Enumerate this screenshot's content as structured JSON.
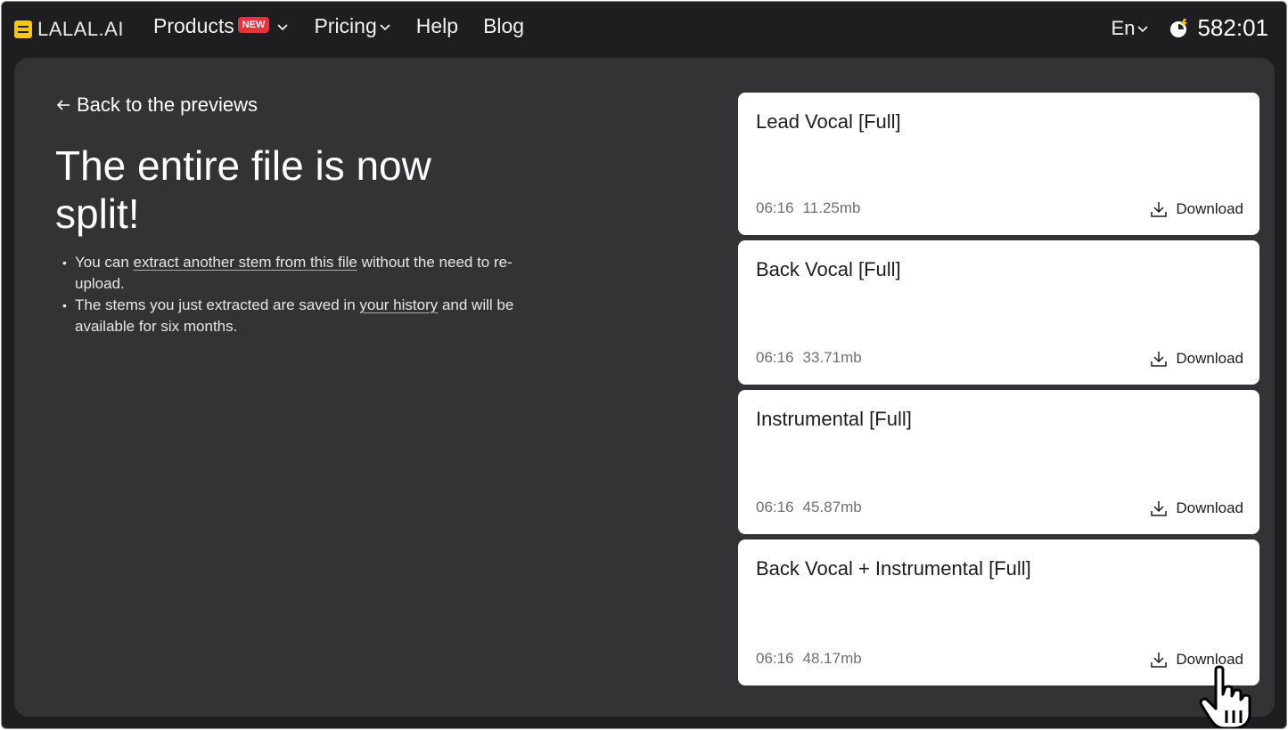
{
  "header": {
    "logo_text": "LALAL.AI",
    "nav": [
      {
        "label": "Products",
        "badge": "NEW",
        "has_dropdown": true
      },
      {
        "label": "Pricing",
        "has_dropdown": true
      },
      {
        "label": "Help",
        "has_dropdown": false
      },
      {
        "label": "Blog",
        "has_dropdown": false
      }
    ],
    "language": "En",
    "credits": "582:01"
  },
  "main": {
    "back_link": "Back to the previews",
    "headline": "The entire file is now split!",
    "notes": {
      "n1_pre": "You can ",
      "n1_link": "extract another stem from this file",
      "n1_post": " without the need to re-upload.",
      "n2_pre": "The stems you just extracted are saved in ",
      "n2_link": "your history",
      "n2_post": " and will be available for six months."
    }
  },
  "stems": [
    {
      "title": "Lead Vocal [Full]",
      "duration": "06:16",
      "size": "11.25mb",
      "download_label": "Download"
    },
    {
      "title": "Back Vocal [Full]",
      "duration": "06:16",
      "size": "33.71mb",
      "download_label": "Download"
    },
    {
      "title": "Instrumental [Full]",
      "duration": "06:16",
      "size": "45.87mb",
      "download_label": "Download"
    },
    {
      "title": "Back Vocal + Instrumental [Full]",
      "duration": "06:16",
      "size": "48.17mb",
      "download_label": "Download"
    }
  ],
  "colors": {
    "background": "#1e1d20",
    "panel": "#333235",
    "card": "#ffffff",
    "badge": "#e8323e",
    "logo": "#f5c518"
  }
}
